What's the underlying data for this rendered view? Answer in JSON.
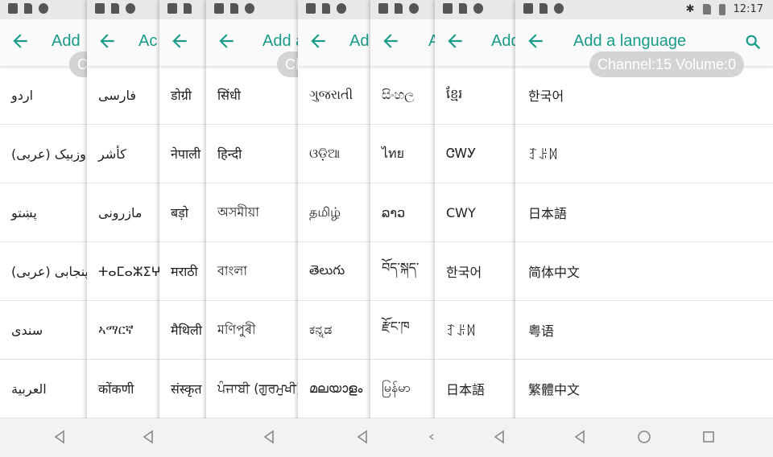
{
  "accent_color": "#1a9b8a",
  "status_bar": {
    "time": "12:17",
    "left_icons": [
      "image-icon",
      "sim-icon",
      "firefox-icon"
    ],
    "right_icons": [
      "bluetooth-icon",
      "no-sim-icon",
      "battery-icon"
    ]
  },
  "toast": "Channel:15  Volume:0",
  "strips": [
    {
      "title": "Add",
      "chip": "C",
      "items": [
        "اردو",
        "اوزبیک (عربی)",
        "پښتو",
        "پنجابی (عربی)",
        "سندی",
        "العربية"
      ]
    },
    {
      "title": "Ac",
      "items": [
        "فارسی",
        "کأشر",
        "مازرونی",
        "ⵜⴰⵎⴰⵣⵉⵖⵜ",
        "ኣማርኛ",
        "कोंकणी"
      ]
    },
    {
      "title": "",
      "items": [
        "डोग्री",
        "नेपाली",
        "बड़ो",
        "मराठी",
        "मैथिली",
        "संस्कृत"
      ]
    },
    {
      "title": "Add a",
      "chip": "Ch",
      "items": [
        "सिंधी",
        "हिन्दी",
        "অসমীয়া",
        "বাংলা",
        "মণিপুৰী",
        "ਪੰਜਾਬੀ (ਗੁਰਮੁਖੀ)"
      ]
    },
    {
      "title": "Ad",
      "items": [
        "ગુજરાતી",
        "ଓଡ଼ିଆ",
        "தமிழ்",
        "తెలుగు",
        "ಕನ್ನಡ",
        "മലയാളം"
      ]
    },
    {
      "title": "A",
      "items": [
        "සිංහල",
        "ไทย",
        "ລາວ",
        "བོད་སྐད་",
        "རྫོང་ཁ",
        "မြန်မာ"
      ]
    },
    {
      "title": "Add",
      "items": [
        "ខ្មែរ",
        "ᏣᎳᎩ",
        "CWY",
        "한국어",
        "ꆈꌠꉙ",
        "日本語"
      ]
    },
    {
      "title": "Add a language",
      "items": [
        "한국어",
        "ꆈꌠꉙ",
        "日本語",
        "简体中文",
        "粤语",
        "繁體中文"
      ]
    }
  ]
}
